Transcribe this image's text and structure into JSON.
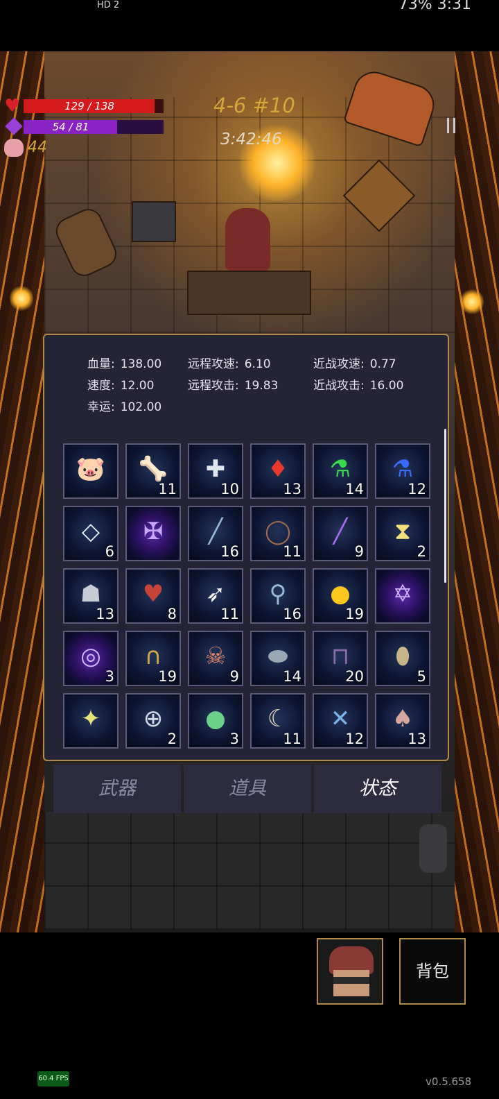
{
  "status_bar": {
    "left": "HD 2",
    "right": "73% 3:31"
  },
  "hud": {
    "hp_text": "129 / 138",
    "hp_fraction": 0.935,
    "mp_text": "54 / 81",
    "mp_fraction": 0.667,
    "coins": "44",
    "stage": "4-6 #10",
    "timer": "3:42:46",
    "pause_symbol": "II"
  },
  "stats": {
    "hp": {
      "label": "血量:",
      "value": "138.00"
    },
    "ranged_speed": {
      "label": "远程攻速:",
      "value": "6.10"
    },
    "melee_speed": {
      "label": "近战攻速:",
      "value": "0.77"
    },
    "speed": {
      "label": "速度:",
      "value": "12.00"
    },
    "ranged_attack": {
      "label": "远程攻击:",
      "value": "19.83"
    },
    "melee_attack": {
      "label": "近战攻击:",
      "value": "16.00"
    },
    "luck": {
      "label": "幸运:",
      "value": "102.00"
    }
  },
  "inventory": [
    {
      "icon": "piggy-bank",
      "count": ""
    },
    {
      "icon": "bone-pile",
      "count": "11"
    },
    {
      "icon": "medkit",
      "count": "10"
    },
    {
      "icon": "red-crystal",
      "count": "13"
    },
    {
      "icon": "green-potion",
      "count": "14"
    },
    {
      "icon": "blue-potion",
      "count": "12"
    },
    {
      "icon": "crystal-diamond",
      "count": "6"
    },
    {
      "icon": "rune-cross",
      "count": ""
    },
    {
      "icon": "glass-vial",
      "count": "16"
    },
    {
      "icon": "thorn-ring",
      "count": "11"
    },
    {
      "icon": "purple-wand",
      "count": "9"
    },
    {
      "icon": "yellow-hourglass-card",
      "count": "2"
    },
    {
      "icon": "ghost-cloak",
      "count": "13"
    },
    {
      "icon": "heart-organ",
      "count": "8"
    },
    {
      "icon": "feather",
      "count": "11"
    },
    {
      "icon": "wrench-key",
      "count": "16"
    },
    {
      "icon": "sun-orb",
      "count": "19"
    },
    {
      "icon": "rune-star",
      "count": ""
    },
    {
      "icon": "rune-spiral",
      "count": "3"
    },
    {
      "icon": "horseshoe",
      "count": "19"
    },
    {
      "icon": "feather-skull",
      "count": "9"
    },
    {
      "icon": "stone",
      "count": "14"
    },
    {
      "icon": "boots",
      "count": "20"
    },
    {
      "icon": "egg-pouch",
      "count": "5"
    },
    {
      "icon": "spiked-star",
      "count": ""
    },
    {
      "icon": "medic-ring",
      "count": "2"
    },
    {
      "icon": "rainbow-orb",
      "count": "3"
    },
    {
      "icon": "horn",
      "count": "11"
    },
    {
      "icon": "dragonfly",
      "count": "12"
    },
    {
      "icon": "mushroom",
      "count": "13"
    }
  ],
  "tabs": {
    "weapons": "武器",
    "items": "道具",
    "status": "状态"
  },
  "bottom": {
    "backpack": "背包",
    "fps": "60.4 FPS",
    "version": "v0.5.658"
  },
  "colors": {
    "hp": "#d41a1a",
    "mp": "#8b22c4",
    "gold": "#d6a63a",
    "panel_border": "#b08a4a"
  }
}
